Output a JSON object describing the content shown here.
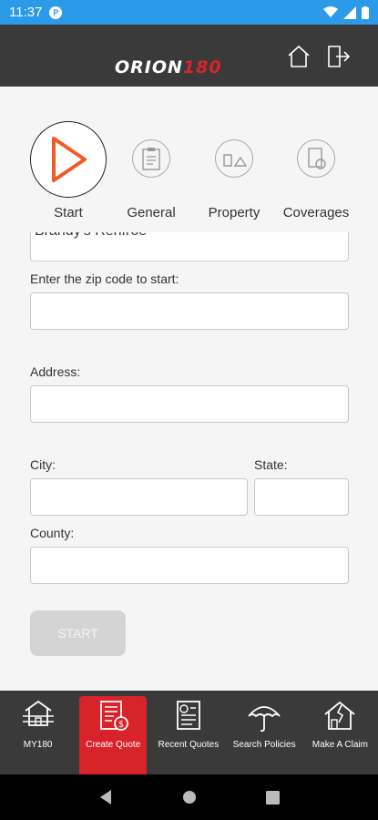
{
  "status_bar": {
    "time": "11:37"
  },
  "header": {
    "logo_part1": "ORION",
    "logo_part2": "180"
  },
  "steps": [
    {
      "label": "Start",
      "state": "active",
      "icon": "play-icon"
    },
    {
      "label": "General",
      "state": "inactive",
      "icon": "clipboard-icon"
    },
    {
      "label": "Property",
      "state": "inactive",
      "icon": "property-icon"
    },
    {
      "label": "Coverages",
      "state": "inactive",
      "icon": "coverages-icon"
    }
  ],
  "form": {
    "truncated_value": "Brandy's Renfroe",
    "zip_label": "Enter the zip code to start:",
    "zip_value": "",
    "address_label": "Address:",
    "address_value": "",
    "city_label": "City:",
    "city_value": "",
    "state_label": "State:",
    "state_value": "",
    "county_label": "County:",
    "county_value": "",
    "start_button": "START"
  },
  "bottom_nav": [
    {
      "label": "MY180",
      "icon": "house-stack-icon",
      "active": false
    },
    {
      "label": "Create Quote",
      "icon": "quote-doc-icon",
      "active": true
    },
    {
      "label": "Recent Quotes",
      "icon": "recent-doc-icon",
      "active": false
    },
    {
      "label": "Search Policies",
      "icon": "umbrella-icon",
      "active": false
    },
    {
      "label": "Make A Claim",
      "icon": "damaged-house-icon",
      "active": false
    }
  ],
  "colors": {
    "accent_red": "#d8232a",
    "status_blue": "#2b9be9",
    "header_dark": "#3a3a3a",
    "play_orange": "#f05a23"
  }
}
